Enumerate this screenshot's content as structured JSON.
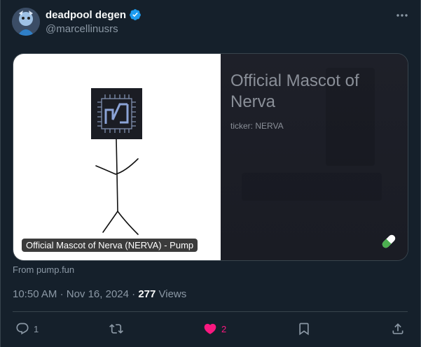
{
  "tweet": {
    "author": {
      "display_name": "deadpool degen",
      "handle": "@marcellinusrs",
      "verified": true
    },
    "card": {
      "title": "Official Mascot of Nerva",
      "ticker": "ticker: NERVA",
      "media_label": "Official Mascot of Nerva (NERVA) - Pump",
      "source": "From pump.fun"
    },
    "meta": {
      "time": "10:50 AM",
      "separator": "·",
      "date": "Nov 16, 2024",
      "views_count": "277",
      "views_label": "Views"
    },
    "actions": {
      "reply_count": "1",
      "like_count": "2"
    }
  },
  "colors": {
    "background": "#15202b",
    "like": "#f91880",
    "verified": "#1d9bf0"
  },
  "icons": [
    "avatar",
    "verified-badge-icon",
    "more-icon",
    "pill-icon",
    "reply-icon",
    "retweet-icon",
    "heart-icon",
    "bookmark-icon",
    "share-icon"
  ]
}
